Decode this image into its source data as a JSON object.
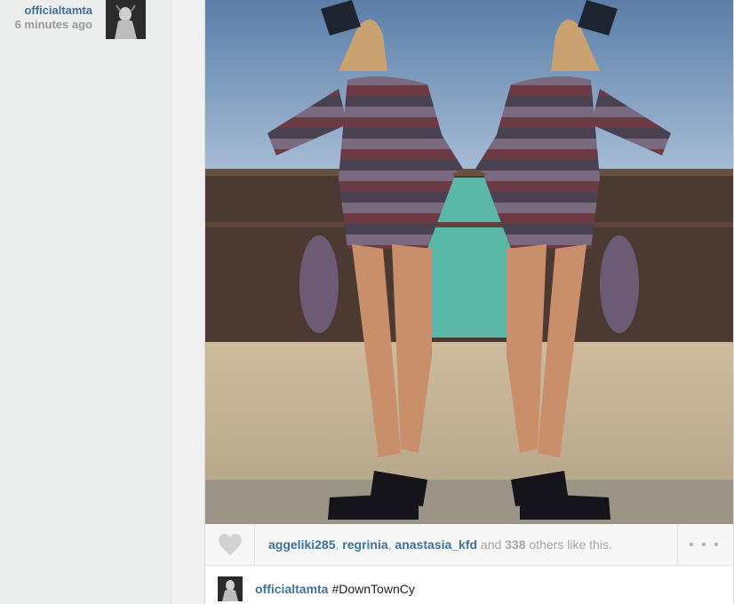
{
  "post": {
    "username": "officialtamta",
    "time_ago": "6 minutes ago"
  },
  "likes": {
    "user1": "aggeliki285",
    "comma1": ", ",
    "user2": "regrinia",
    "comma2": ", ",
    "user3": "anastasia_kfd",
    "and": " and ",
    "count": "338",
    "suffix": " others like this."
  },
  "more_label": "• • •",
  "caption": {
    "username": "officialtamta",
    "text": "#DownTownCy"
  },
  "colors": {
    "link": "#3f729b",
    "muted": "#a5a5a5"
  },
  "icons": {
    "like": "heart-icon",
    "options": "more-options-icon"
  }
}
